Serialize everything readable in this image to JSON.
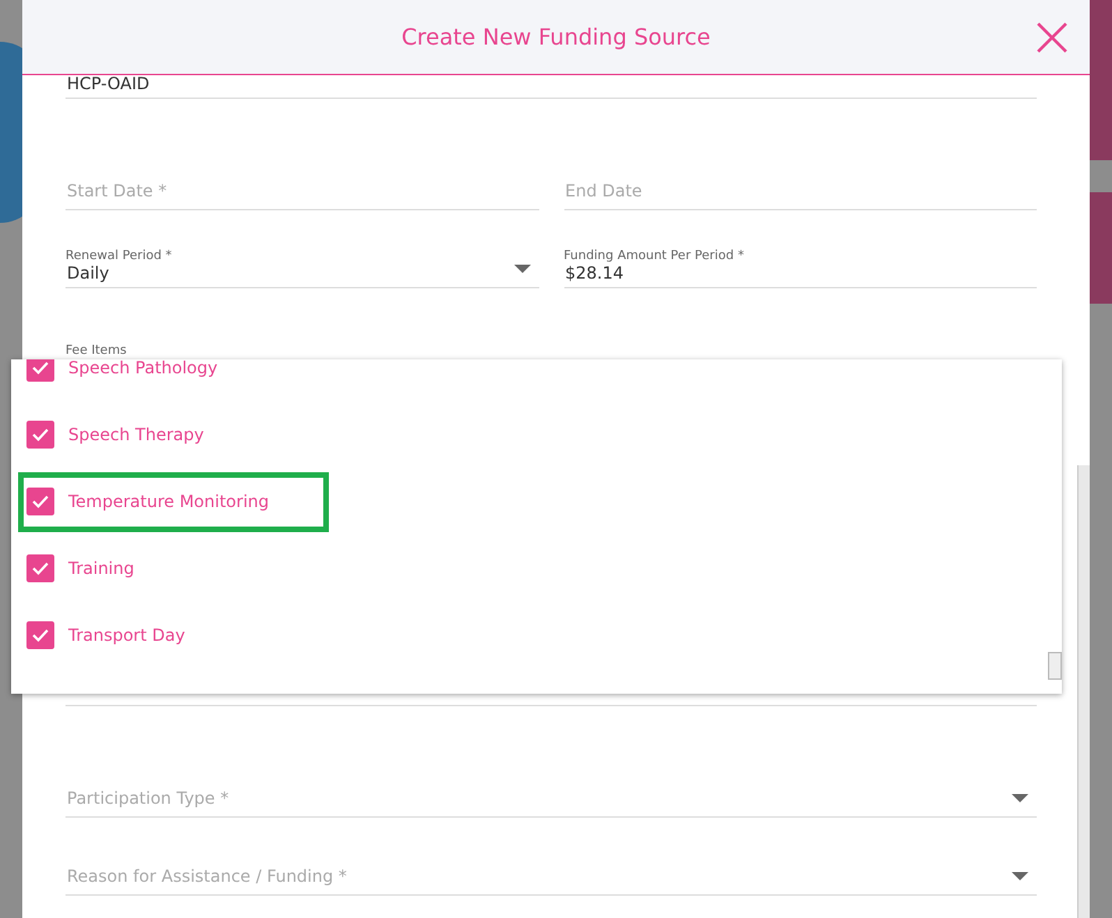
{
  "dialog": {
    "title": "Create New Funding Source"
  },
  "top_fields": [
    {
      "value": "HCP-OAID"
    }
  ],
  "rows": [
    [
      {
        "kind": "text",
        "placeholder": "Start Date *"
      },
      {
        "kind": "text",
        "placeholder": "End Date"
      }
    ],
    [
      {
        "kind": "select",
        "label": "Renewal Period *",
        "value": "Daily"
      },
      {
        "kind": "text",
        "label": "Funding Amount Per Period *",
        "value": "$28.14"
      }
    ]
  ],
  "fee_items": {
    "label": "Fee Items",
    "options": [
      {
        "label": "Speech Pathology",
        "checked": true,
        "highlighted": false
      },
      {
        "label": "Speech Therapy",
        "checked": true,
        "highlighted": false
      },
      {
        "label": "Temperature Monitoring",
        "checked": true,
        "highlighted": true
      },
      {
        "label": "Training",
        "checked": true,
        "highlighted": false
      },
      {
        "label": "Transport Day",
        "checked": true,
        "highlighted": false
      }
    ]
  },
  "bottom_fields": [
    {
      "kind": "select",
      "placeholder": "Participation Type *"
    },
    {
      "kind": "select",
      "placeholder": "Reason for Assistance / Funding *"
    }
  ]
}
